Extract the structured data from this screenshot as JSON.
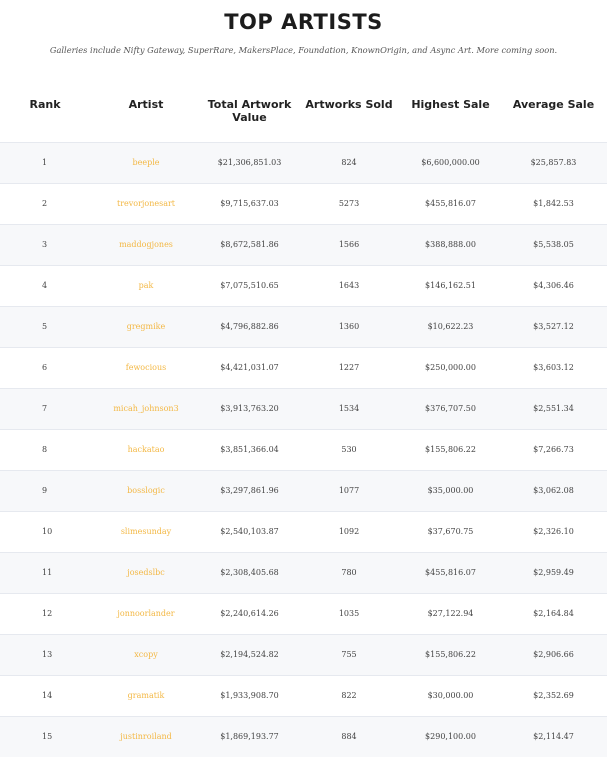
{
  "page": {
    "title": "TOP ARTISTS",
    "subtitle": "Galleries include Nifty Gateway, SuperRare, MakersPlace, Foundation, KnownOrigin, and Async Art. More coming soon."
  },
  "colors": {
    "artist_link": "#f3b845",
    "row_alt": "#f7f8fa",
    "divider": "#e6e9ef"
  },
  "table": {
    "headers": [
      "Rank",
      "Artist",
      "Total Artwork Value",
      "Artworks Sold",
      "Highest Sale",
      "Average Sale"
    ],
    "rows": [
      {
        "rank": "1",
        "artist": "beeple",
        "total": "$21,306,851.03",
        "sold": "824",
        "highest": "$6,600,000.00",
        "average": "$25,857.83"
      },
      {
        "rank": "2",
        "artist": "trevorjonesart",
        "total": "$9,715,637.03",
        "sold": "5273",
        "highest": "$455,816.07",
        "average": "$1,842.53"
      },
      {
        "rank": "3",
        "artist": "maddogjones",
        "total": "$8,672,581.86",
        "sold": "1566",
        "highest": "$388,888.00",
        "average": "$5,538.05"
      },
      {
        "rank": "4",
        "artist": "pak",
        "total": "$7,075,510.65",
        "sold": "1643",
        "highest": "$146,162.51",
        "average": "$4,306.46"
      },
      {
        "rank": "5",
        "artist": "gregmike",
        "total": "$4,796,882.86",
        "sold": "1360",
        "highest": "$10,622.23",
        "average": "$3,527.12"
      },
      {
        "rank": "6",
        "artist": "fewocious",
        "total": "$4,421,031.07",
        "sold": "1227",
        "highest": "$250,000.00",
        "average": "$3,603.12"
      },
      {
        "rank": "7",
        "artist": "micah_johnson3",
        "total": "$3,913,763.20",
        "sold": "1534",
        "highest": "$376,707.50",
        "average": "$2,551.34"
      },
      {
        "rank": "8",
        "artist": "hackatao",
        "total": "$3,851,366.04",
        "sold": "530",
        "highest": "$155,806.22",
        "average": "$7,266.73"
      },
      {
        "rank": "9",
        "artist": "bosslogic",
        "total": "$3,297,861.96",
        "sold": "1077",
        "highest": "$35,000.00",
        "average": "$3,062.08"
      },
      {
        "rank": "10",
        "artist": "slimesunday",
        "total": "$2,540,103.87",
        "sold": "1092",
        "highest": "$37,670.75",
        "average": "$2,326.10"
      },
      {
        "rank": "11",
        "artist": "josedslbc",
        "total": "$2,308,405.68",
        "sold": "780",
        "highest": "$455,816.07",
        "average": "$2,959.49"
      },
      {
        "rank": "12",
        "artist": "jonnoorlander",
        "total": "$2,240,614.26",
        "sold": "1035",
        "highest": "$27,122.94",
        "average": "$2,164.84"
      },
      {
        "rank": "13",
        "artist": "xcopy",
        "total": "$2,194,524.82",
        "sold": "755",
        "highest": "$155,806.22",
        "average": "$2,906.66"
      },
      {
        "rank": "14",
        "artist": "gramatik",
        "total": "$1,933,908.70",
        "sold": "822",
        "highest": "$30,000.00",
        "average": "$2,352.69"
      },
      {
        "rank": "15",
        "artist": "justinroiland",
        "total": "$1,869,193.77",
        "sold": "884",
        "highest": "$290,100.00",
        "average": "$2,114.47"
      }
    ]
  }
}
